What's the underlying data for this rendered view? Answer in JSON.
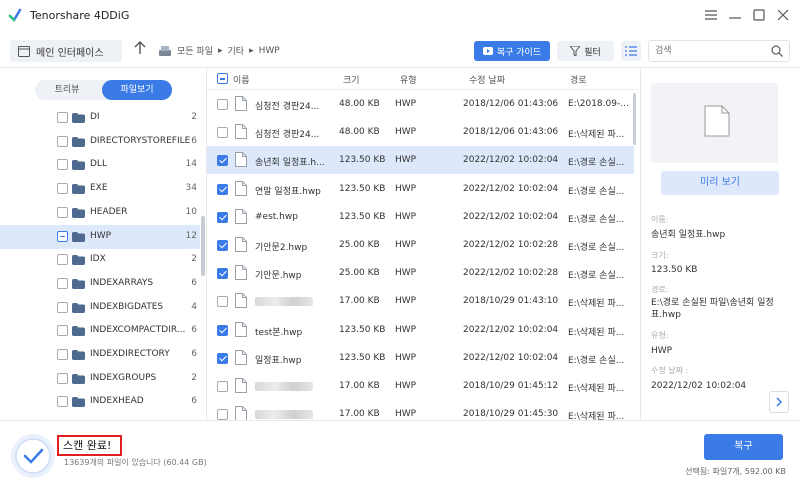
{
  "app": {
    "title": "Tenorshare 4DDiG",
    "brand_color": "#3a7be8"
  },
  "toolbar": {
    "home_label": "메인 인터페이스",
    "breadcrumb": [
      "모든 파일",
      "기타",
      "HWP"
    ],
    "guide_label": "복구 가이드",
    "filter_label": "필터",
    "search_placeholder": "검색"
  },
  "left": {
    "toggle": {
      "tree": "트리뷰",
      "file": "파일보기"
    },
    "folders": [
      {
        "name": "DI",
        "count": "2"
      },
      {
        "name": "DIRECTORYSTOREFILE",
        "count": "6"
      },
      {
        "name": "DLL",
        "count": "14"
      },
      {
        "name": "EXE",
        "count": "34"
      },
      {
        "name": "HEADER",
        "count": "10"
      },
      {
        "name": "HWP",
        "count": "12"
      },
      {
        "name": "IDX",
        "count": "2"
      },
      {
        "name": "INDEXARRAYS",
        "count": "6"
      },
      {
        "name": "INDEXBIGDATES",
        "count": "4"
      },
      {
        "name": "INDEXCOMPACTDIR...",
        "count": "6"
      },
      {
        "name": "INDEXDIRECTORY",
        "count": "6"
      },
      {
        "name": "INDEXGROUPS",
        "count": "2"
      },
      {
        "name": "INDEXHEAD",
        "count": "6"
      }
    ]
  },
  "table": {
    "headers": {
      "name": "이름",
      "size": "크기",
      "type": "유형",
      "modified": "수정 날짜",
      "path": "경로"
    },
    "rows": [
      {
        "name": "심청전 경판24...",
        "size": "48.00 KB",
        "type": "HWP",
        "modified": "2018/12/06 01:43:06",
        "path": "E:\\2018.09-..."
      },
      {
        "name": "심청전 경판24...",
        "size": "48.00 KB",
        "type": "HWP",
        "modified": "2018/12/06 01:43:06",
        "path": "E:\\삭제된 파..."
      },
      {
        "name": "송년회 일정표.h...",
        "size": "123.50 KB",
        "type": "HWP",
        "modified": "2022/12/02 10:02:04",
        "path": "E:\\경로 손실..."
      },
      {
        "name": "연말 일정표.hwp",
        "size": "123.50 KB",
        "type": "HWP",
        "modified": "2022/12/02 10:02:04",
        "path": "E:\\경로 손실..."
      },
      {
        "name": "#est.hwp",
        "size": "123.50 KB",
        "type": "HWP",
        "modified": "2022/12/02 10:02:04",
        "path": "E:\\경로 손실..."
      },
      {
        "name": "기안문2.hwp",
        "size": "25.00 KB",
        "type": "HWP",
        "modified": "2022/12/02 10:02:28",
        "path": "E:\\경로 손실..."
      },
      {
        "name": "기안문.hwp",
        "size": "25.00 KB",
        "type": "HWP",
        "modified": "2022/12/02 10:02:28",
        "path": "E:\\경로 손실..."
      },
      {
        "name": "",
        "size": "17.00 KB",
        "type": "HWP",
        "modified": "2018/10/29 01:43:10",
        "path": "E:\\삭제된 파..."
      },
      {
        "name": "test본.hwp",
        "size": "123.50 KB",
        "type": "HWP",
        "modified": "2022/12/02 10:02:04",
        "path": "E:\\삭제된 파..."
      },
      {
        "name": "일정표.hwp",
        "size": "123.50 KB",
        "type": "HWP",
        "modified": "2022/12/02 10:02:04",
        "path": "E:\\경로 손실..."
      },
      {
        "name": "",
        "size": "17.00 KB",
        "type": "HWP",
        "modified": "2018/10/29 01:45:12",
        "path": "E:\\삭제된 파..."
      },
      {
        "name": "",
        "size": "17.00 KB",
        "type": "HWP",
        "modified": "2018/10/29 01:45:30",
        "path": "E:\\삭제된 파..."
      }
    ]
  },
  "details": {
    "preview_label": "미리 보기",
    "name_key": "이름:",
    "name_val": "송년회 일정표.hwp",
    "size_key": "크기:",
    "size_val": "123.50 KB",
    "path_key": "경로:",
    "path_val": "E:\\경로 손실된 파일\\송년회 일정표.hwp",
    "type_key": "유형:",
    "type_val": "HWP",
    "mod_key": "수정 날짜 :",
    "mod_val": "2022/12/02 10:02:04"
  },
  "bottom": {
    "scan_done": "스캔 완료!",
    "scan_sub": "13639개의 파일이 있습니다 (60.44 GB)",
    "recover_label": "복구",
    "selected_info": "선택됨: 파일7개, 592.00 KB"
  }
}
